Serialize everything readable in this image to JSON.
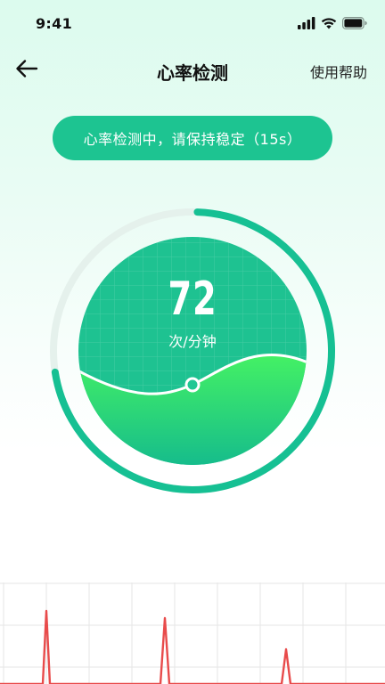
{
  "status_bar": {
    "time": "9:41",
    "icons": [
      "signal-icon",
      "wifi-icon",
      "battery-icon"
    ]
  },
  "nav": {
    "title": "心率检测",
    "help_label": "使用帮助",
    "back_icon": "arrow-left-icon"
  },
  "status_message": "心率检测中，请保持稳定（15s）",
  "measurement": {
    "bpm": "72",
    "unit": "次/分钟",
    "progress": 0.72
  },
  "colors": {
    "accent": "#1dc491",
    "gauge_ring": "#16c093",
    "gauge_track": "#e5f1ec",
    "ecg_line": "#e84b4b"
  }
}
